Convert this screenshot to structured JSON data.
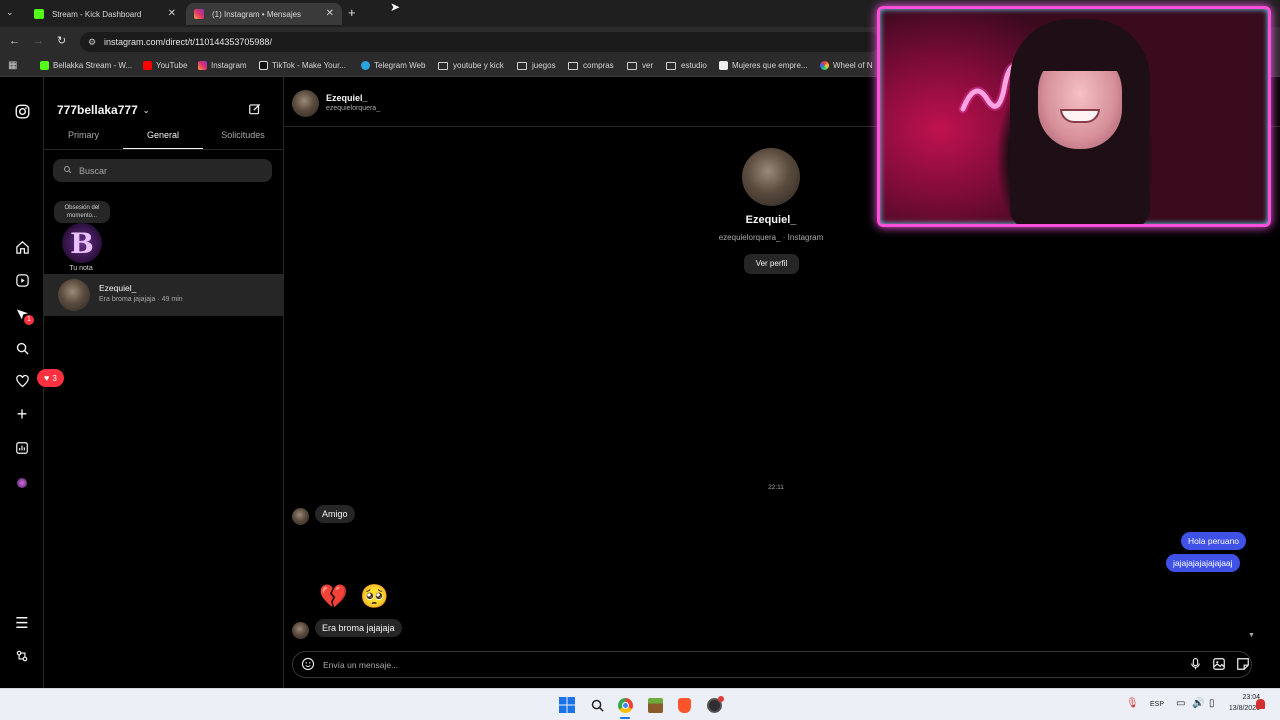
{
  "browser": {
    "tabs": [
      {
        "title": "Stream - Kick Dashboard",
        "active": false
      },
      {
        "title": "(1) Instagram • Mensajes",
        "active": true
      }
    ],
    "url": "instagram.com/direct/t/110144353705988/",
    "bookmarks": [
      "Bellakka Stream - W...",
      "YouTube",
      "Instagram",
      "TikTok - Make Your...",
      "Telegram Web",
      "youtube y kick",
      "juegos",
      "compras",
      "ver",
      "estudio",
      "Mujeres que empre...",
      "Wheel of N"
    ]
  },
  "inbox": {
    "username": "777bellaka777",
    "tabs": [
      "Primary",
      "General",
      "Solicitudes"
    ],
    "active_tab": "General",
    "search_placeholder": "Buscar",
    "note": {
      "text": "Obsesión del momento...",
      "label": "Tu nota"
    },
    "threads": [
      {
        "name": "Ezequiel_",
        "preview": "Era broma jajajaja · 49 min"
      }
    ]
  },
  "nav": {
    "notifications_badge": "1",
    "likes_badge": "3"
  },
  "chat": {
    "header_name": "Ezequiel_",
    "header_handle": "ezequielorquera_",
    "profile_name": "Ezequiel_",
    "profile_sub": "ezequielorquera_ · Instagram",
    "view_profile": "Ver perfil",
    "timestamp": "22:11",
    "messages_in": [
      "Amigo",
      "Era broma jajajaja"
    ],
    "messages_out": [
      "Hola peruano",
      "jajajajajajajajaaj"
    ],
    "emojis": [
      "💔",
      "🥺"
    ],
    "composer_placeholder": "Envía un mensaje..."
  },
  "taskbar": {
    "lang": "ESP",
    "time": "23:04",
    "date": "13/8/2026"
  },
  "colors": {
    "outgoing_bubble": "#3f51e6",
    "incoming_bubble": "#262626",
    "webcam_border": "#ff4fd8"
  }
}
